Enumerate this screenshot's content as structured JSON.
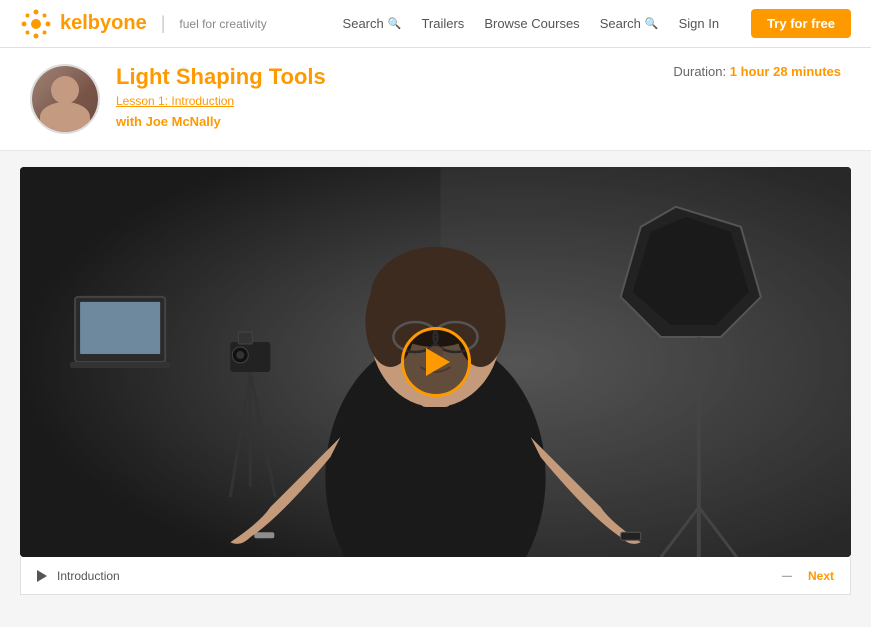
{
  "header": {
    "logo_brand": "kelbyone",
    "logo_tagline": "fuel for creativity",
    "nav": {
      "search1_label": "Search",
      "trailers_label": "Trailers",
      "browse_label": "Browse Courses",
      "search2_label": "Search",
      "signin_label": "Sign In",
      "try_label": "Try for free"
    }
  },
  "course": {
    "title": "Light Shaping Tools",
    "lesson_link": "Lesson 1: Introduction",
    "instructor_prefix": "with ",
    "instructor_name": "Joe McNally",
    "duration_label": "Duration:",
    "duration_value": "1 hour 28 minutes"
  },
  "video": {
    "controls": {
      "lesson_label": "Introduction",
      "minimize_label": "–",
      "next_label": "Next"
    }
  }
}
